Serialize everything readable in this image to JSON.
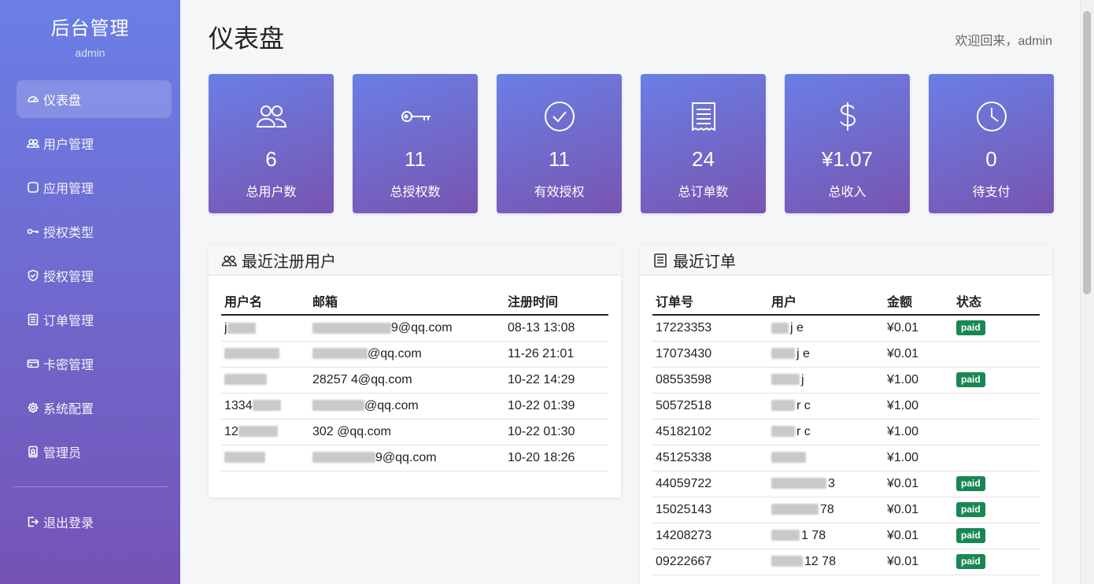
{
  "sidebar": {
    "title": "后台管理",
    "user": "admin",
    "items": [
      {
        "label": "仪表盘",
        "icon": "dashboard-icon",
        "active": true
      },
      {
        "label": "用户管理",
        "icon": "users-icon"
      },
      {
        "label": "应用管理",
        "icon": "app-icon"
      },
      {
        "label": "授权类型",
        "icon": "key-icon"
      },
      {
        "label": "授权管理",
        "icon": "shield-icon"
      },
      {
        "label": "订单管理",
        "icon": "receipt-icon"
      },
      {
        "label": "卡密管理",
        "icon": "card-icon"
      },
      {
        "label": "系统配置",
        "icon": "gear-icon"
      },
      {
        "label": "管理员",
        "icon": "admin-badge-icon"
      }
    ],
    "logout": {
      "label": "退出登录",
      "icon": "logout-icon"
    }
  },
  "header": {
    "title": "仪表盘",
    "welcome": "欢迎回来，admin"
  },
  "stats": [
    {
      "value": "6",
      "label": "总用户数",
      "icon": "users-icon"
    },
    {
      "value": "11",
      "label": "总授权数",
      "icon": "key-icon"
    },
    {
      "value": "11",
      "label": "有效授权",
      "icon": "check-circle-icon"
    },
    {
      "value": "24",
      "label": "总订单数",
      "icon": "receipt-icon"
    },
    {
      "value": "¥1.07",
      "label": "总收入",
      "icon": "dollar-icon"
    },
    {
      "value": "0",
      "label": "待支付",
      "icon": "clock-icon"
    }
  ],
  "recent_users": {
    "title": "最近注册用户",
    "columns": [
      "用户名",
      "邮箱",
      "注册时间"
    ],
    "rows": [
      {
        "username": "j",
        "email": "9@qq.com",
        "time": "08-13 13:08"
      },
      {
        "username": "",
        "email": "@qq.com",
        "time": "11-26 21:01"
      },
      {
        "username": "",
        "email": "28257 4@qq.com",
        "time": "10-22 14:29"
      },
      {
        "username": "1334",
        "email": "@qq.com",
        "time": "10-22 01:39"
      },
      {
        "username": "12",
        "email": "302 @qq.com",
        "time": "10-22 01:30"
      },
      {
        "username": "",
        "email": "9@qq.com",
        "time": "10-20 18:26"
      }
    ]
  },
  "recent_orders": {
    "title": "最近订单",
    "columns": [
      "订单号",
      "用户",
      "金额",
      "状态"
    ],
    "rows": [
      {
        "order": "17223353",
        "user": "j e",
        "amount": "¥0.01",
        "status": "paid"
      },
      {
        "order": "17073430",
        "user": "j e",
        "amount": "¥0.01",
        "status": ""
      },
      {
        "order": "08553598",
        "user": "j",
        "amount": "¥1.00",
        "status": "paid"
      },
      {
        "order": "50572518",
        "user": "r c",
        "amount": "¥1.00",
        "status": ""
      },
      {
        "order": "45182102",
        "user": "r c",
        "amount": "¥1.00",
        "status": ""
      },
      {
        "order": "45125338",
        "user": "",
        "amount": "¥1.00",
        "status": ""
      },
      {
        "order": "44059722",
        "user": "3",
        "amount": "¥0.01",
        "status": "paid"
      },
      {
        "order": "15025143",
        "user": "78",
        "amount": "¥0.01",
        "status": "paid"
      },
      {
        "order": "14208273",
        "user": "1 78",
        "amount": "¥0.01",
        "status": "paid"
      },
      {
        "order": "09222667",
        "user": "12 78",
        "amount": "¥0.01",
        "status": "paid"
      }
    ]
  },
  "colors": {
    "gradient_start": "#6a7fe6",
    "gradient_end": "#7553b5",
    "paid_badge": "#198754"
  }
}
